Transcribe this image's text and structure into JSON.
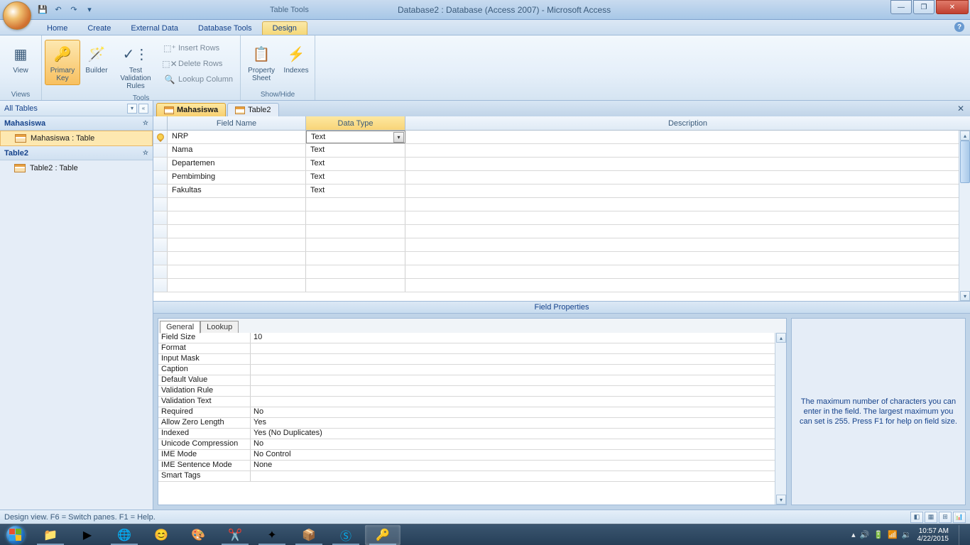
{
  "titlebar": {
    "tool_context": "Table Tools",
    "app_title": "Database2 : Database (Access 2007)  -  Microsoft Access"
  },
  "ribbon_tabs": {
    "home": "Home",
    "create": "Create",
    "external": "External Data",
    "dbtools": "Database Tools",
    "design": "Design"
  },
  "ribbon": {
    "views_group": "Views",
    "view": "View",
    "tools_group": "Tools",
    "primary_key": "Primary Key",
    "builder": "Builder",
    "test_rules": "Test Validation Rules",
    "insert_rows": "Insert Rows",
    "delete_rows": "Delete Rows",
    "lookup_col": "Lookup Column",
    "showhide_group": "Show/Hide",
    "prop_sheet": "Property Sheet",
    "indexes": "Indexes"
  },
  "nav": {
    "header": "All Tables",
    "groups": [
      {
        "title": "Mahasiswa",
        "items": [
          "Mahasiswa : Table"
        ]
      },
      {
        "title": "Table2",
        "items": [
          "Table2 : Table"
        ]
      }
    ]
  },
  "doc_tabs": {
    "t0": "Mahasiswa",
    "t1": "Table2"
  },
  "grid_headers": {
    "field": "Field Name",
    "type": "Data Type",
    "desc": "Description"
  },
  "fields": [
    {
      "name": "NRP",
      "type": "Text",
      "pk": true,
      "active": true
    },
    {
      "name": "Nama",
      "type": "Text"
    },
    {
      "name": "Departemen",
      "type": "Text"
    },
    {
      "name": "Pembimbing",
      "type": "Text"
    },
    {
      "name": "Fakultas",
      "type": "Text"
    }
  ],
  "fp": {
    "title": "Field Properties",
    "tab_general": "General",
    "tab_lookup": "Lookup",
    "rows": [
      {
        "k": "Field Size",
        "v": "10"
      },
      {
        "k": "Format",
        "v": ""
      },
      {
        "k": "Input Mask",
        "v": ""
      },
      {
        "k": "Caption",
        "v": ""
      },
      {
        "k": "Default Value",
        "v": ""
      },
      {
        "k": "Validation Rule",
        "v": ""
      },
      {
        "k": "Validation Text",
        "v": ""
      },
      {
        "k": "Required",
        "v": "No"
      },
      {
        "k": "Allow Zero Length",
        "v": "Yes"
      },
      {
        "k": "Indexed",
        "v": "Yes (No Duplicates)"
      },
      {
        "k": "Unicode Compression",
        "v": "No"
      },
      {
        "k": "IME Mode",
        "v": "No Control"
      },
      {
        "k": "IME Sentence Mode",
        "v": "None"
      },
      {
        "k": "Smart Tags",
        "v": ""
      }
    ],
    "help": "The maximum number of characters you can enter in the field.  The largest maximum you can set is 255.  Press F1 for help on field size."
  },
  "statusbar": {
    "text": "Design view.   F6 = Switch panes.   F1 = Help."
  },
  "tray": {
    "time": "10:57 AM",
    "date": "4/22/2015"
  }
}
